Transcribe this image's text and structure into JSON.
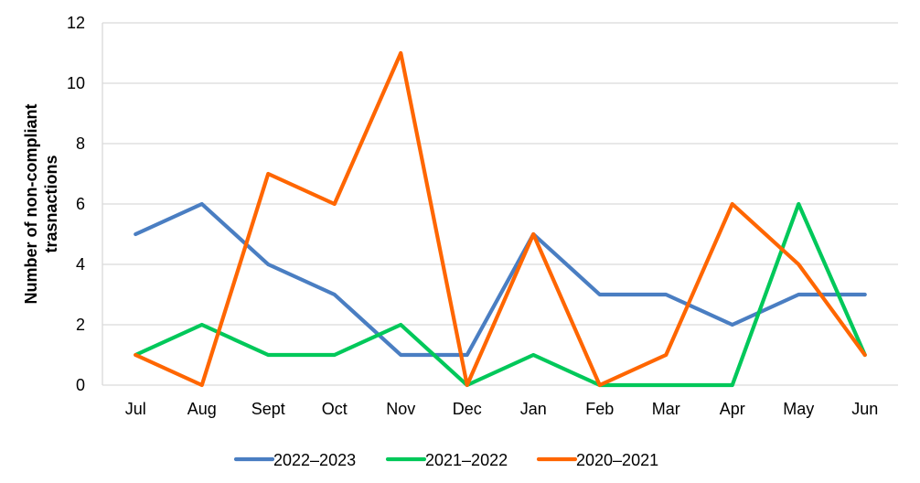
{
  "chart_data": {
    "type": "line",
    "title": "",
    "xlabel": "",
    "ylabel_lines": [
      "Number of non-compliant",
      "trasnactions"
    ],
    "ylabel": "Number of non-compliant trasnactions",
    "categories": [
      "Jul",
      "Aug",
      "Sept",
      "Oct",
      "Nov",
      "Dec",
      "Jan",
      "Feb",
      "Mar",
      "Apr",
      "May",
      "Jun"
    ],
    "ylim": [
      0,
      12
    ],
    "yticks": [
      0,
      2,
      4,
      6,
      8,
      10,
      12
    ],
    "grid": true,
    "legend_position": "bottom",
    "series": [
      {
        "name": "2022–2023",
        "color": "#4A7EC2",
        "values": [
          5,
          6,
          4,
          3,
          1,
          1,
          5,
          3,
          3,
          2,
          3,
          3
        ]
      },
      {
        "name": "2021–2022",
        "color": "#00C85A",
        "values": [
          1,
          2,
          1,
          1,
          2,
          0,
          1,
          0,
          0,
          0,
          6,
          1
        ]
      },
      {
        "name": "2020–2021",
        "color": "#FF6600",
        "values": [
          1,
          0,
          7,
          6,
          11,
          0,
          5,
          0,
          1,
          6,
          4,
          1
        ]
      }
    ]
  }
}
